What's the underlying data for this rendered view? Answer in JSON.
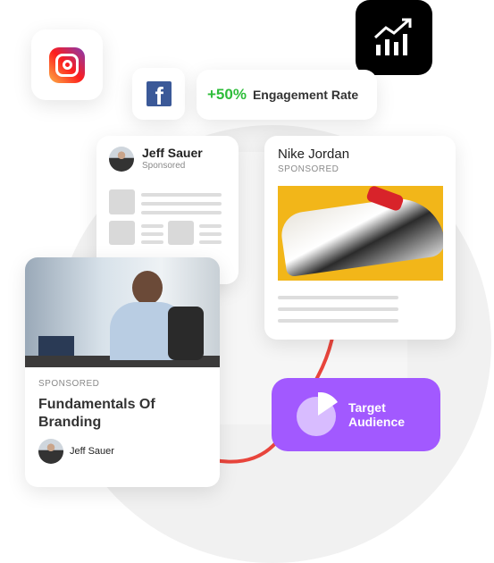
{
  "engagement": {
    "value": "+50%",
    "label": "Engagement Rate",
    "value_color": "#2ebd3a"
  },
  "jeff_card": {
    "name": "Jeff Sauer",
    "subtitle": "Sponsored"
  },
  "nike_card": {
    "title": "Nike Jordan",
    "subtitle": "SPONSORED"
  },
  "course_card": {
    "subtitle": "SPONSORED",
    "title": "Fundamentals Of Branding",
    "author": "Jeff Sauer"
  },
  "target": {
    "label_line1": "Target",
    "label_line2": "Audience",
    "color": "#a259ff"
  }
}
